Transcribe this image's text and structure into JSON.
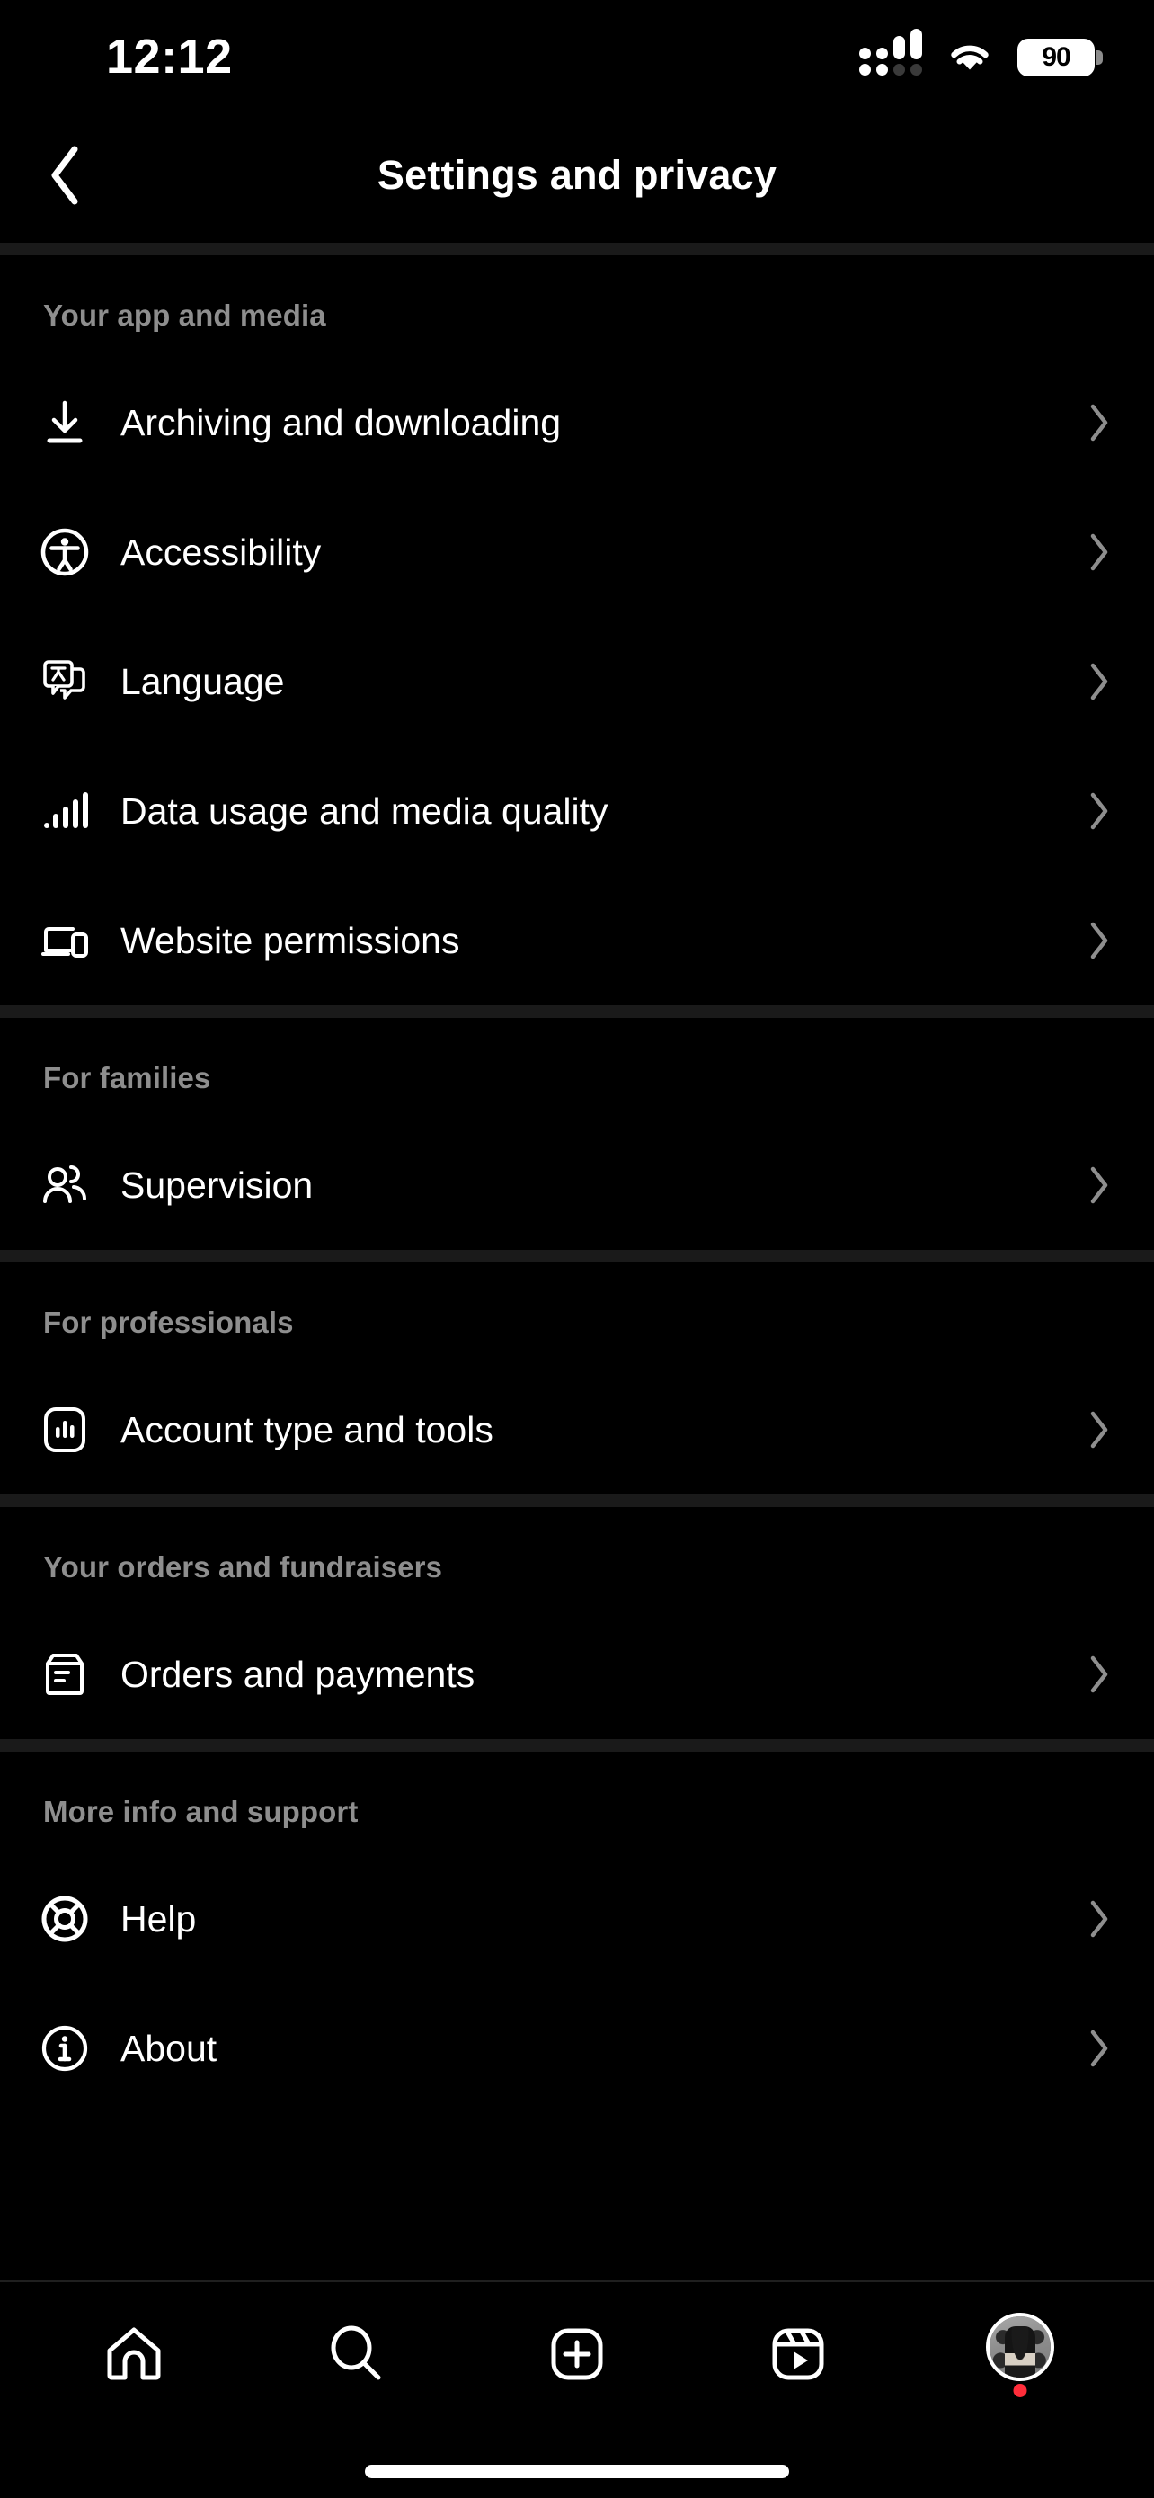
{
  "status_bar": {
    "time": "12:12",
    "battery_level": "90",
    "cellular_icon": "cellular-signal-icon",
    "wifi_icon": "wifi-icon",
    "battery_icon": "battery-icon"
  },
  "header": {
    "title": "Settings and privacy",
    "back_icon": "back-chevron-icon"
  },
  "colors": {
    "background": "#000000",
    "section_divider": "#1a1a1a",
    "section_title": "#8e8e8e",
    "primary_text": "#ffffff",
    "chevron": "#8e8e8e",
    "notification_dot": "#ff2d3a"
  },
  "sections": [
    {
      "title": "Your app and media",
      "items": [
        {
          "label": "Archiving and downloading",
          "icon": "download-icon"
        },
        {
          "label": "Accessibility",
          "icon": "accessibility-icon"
        },
        {
          "label": "Language",
          "icon": "translate-icon"
        },
        {
          "label": "Data usage and media quality",
          "icon": "signal-bars-icon"
        },
        {
          "label": "Website permissions",
          "icon": "devices-icon"
        }
      ]
    },
    {
      "title": "For families",
      "items": [
        {
          "label": "Supervision",
          "icon": "people-icon"
        }
      ]
    },
    {
      "title": "For professionals",
      "items": [
        {
          "label": "Account type and tools",
          "icon": "insights-icon"
        }
      ]
    },
    {
      "title": "Your orders and fundraisers",
      "items": [
        {
          "label": "Orders and payments",
          "icon": "receipt-icon"
        }
      ]
    },
    {
      "title": "More info and support",
      "items": [
        {
          "label": "Help",
          "icon": "life-ring-icon"
        },
        {
          "label": "About",
          "icon": "info-circle-icon"
        }
      ]
    }
  ],
  "tab_bar": {
    "tabs": [
      {
        "name": "home",
        "icon": "home-icon"
      },
      {
        "name": "search",
        "icon": "search-icon"
      },
      {
        "name": "create",
        "icon": "plus-square-icon"
      },
      {
        "name": "reels",
        "icon": "reels-icon"
      },
      {
        "name": "profile",
        "icon": "profile-avatar-icon"
      }
    ]
  }
}
